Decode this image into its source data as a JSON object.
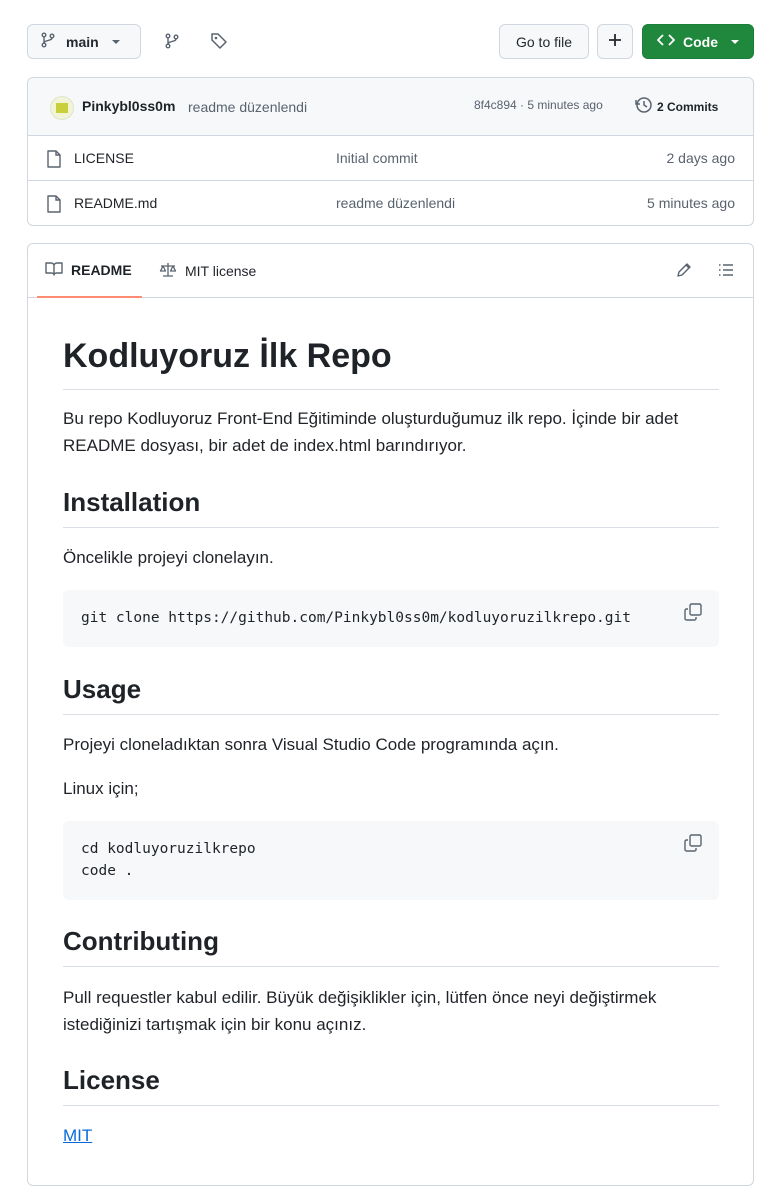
{
  "toolbar": {
    "branch": "main",
    "goto_label": "Go to file",
    "code_label": "Code"
  },
  "latest_commit": {
    "author": "Pinkybl0ss0m",
    "message": "readme düzenlendi",
    "meta": "8f4c894 · 5 minutes ago",
    "commits_count": "2 Commits"
  },
  "files": [
    {
      "name": "LICENSE",
      "commit": "Initial commit",
      "age": "2 days ago"
    },
    {
      "name": "README.md",
      "commit": "readme düzenlendi",
      "age": "5 minutes ago"
    }
  ],
  "readme_tabs": {
    "readme": "README",
    "license": "MIT license"
  },
  "readme": {
    "title": "Kodluyoruz İlk Repo",
    "intro_line1": "Bu repo Kodluyoruz Front-End Eğitiminde oluşturduğumuz ilk repo. İçinde bir adet",
    "intro_line2": "README dosyası, bir adet de index.html barındırıyor.",
    "installation_heading": "Installation",
    "installation_text": "Öncelikle projeyi clonelayın.",
    "installation_code": "git clone https://github.com/Pinkybl0ss0m/kodluyoruzilkrepo.git",
    "usage_heading": "Usage",
    "usage_text": "Projeyi cloneladıktan sonra Visual Studio Code programında açın.",
    "linux_text": "Linux için;",
    "usage_code_line1": "cd kodluyoruzilkrepo",
    "usage_code_line2": "code .",
    "contributing_heading": "Contributing",
    "contributing_line1": "Pull requestler kabul edilir. Büyük değişiklikler için, lütfen önce neyi değiştirmek",
    "contributing_line2": "istediğinizi tartışmak için bir konu açınız.",
    "license_heading": "License",
    "license_link": "MIT"
  }
}
